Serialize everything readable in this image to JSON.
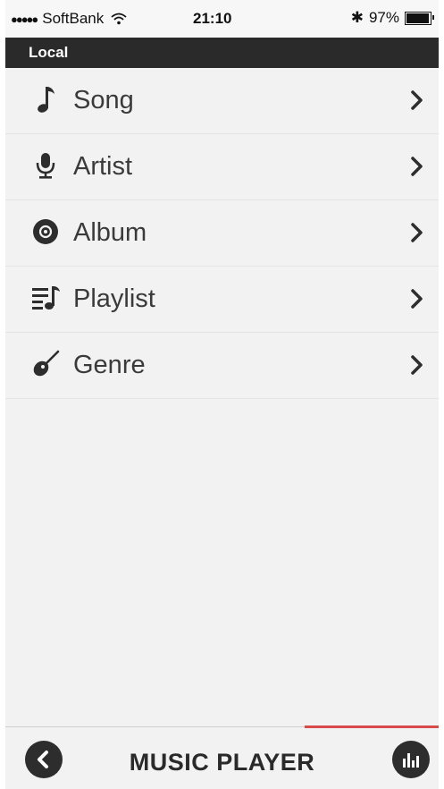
{
  "status_bar": {
    "signal_dots": "●●●●●",
    "carrier": "SoftBank",
    "time": "21:10",
    "bluetooth": "✱",
    "battery_percent": "97%",
    "battery_level": 0.97
  },
  "section": {
    "title": "Local"
  },
  "menu": {
    "items": [
      {
        "label": "Song",
        "icon": "music-note-icon"
      },
      {
        "label": "Artist",
        "icon": "microphone-icon"
      },
      {
        "label": "Album",
        "icon": "album-disc-icon"
      },
      {
        "label": "Playlist",
        "icon": "playlist-icon"
      },
      {
        "label": "Genre",
        "icon": "guitar-icon"
      }
    ]
  },
  "bottom_bar": {
    "title": "MUSIC PLAYER",
    "accent_color": "#d94b4b"
  }
}
